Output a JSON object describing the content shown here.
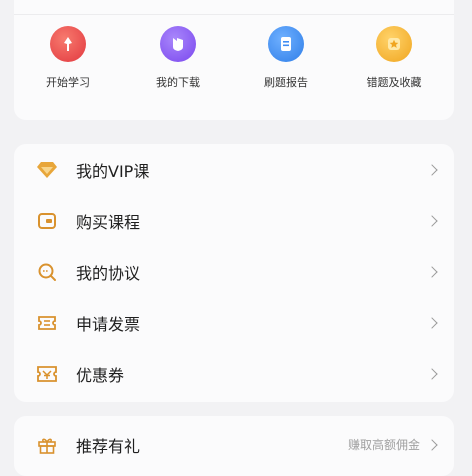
{
  "quick_actions": [
    {
      "label": "开始学习",
      "icon": "pen-icon",
      "color": "#e7474c"
    },
    {
      "label": "我的下载",
      "icon": "download-icon",
      "color": "#8b5cf6"
    },
    {
      "label": "刷题报告",
      "icon": "report-icon",
      "color": "#3f8df3"
    },
    {
      "label": "错题及收藏",
      "icon": "star-icon",
      "color": "#f3b532"
    }
  ],
  "menu": {
    "items": [
      {
        "label": "我的VIP课",
        "icon": "diamond-icon"
      },
      {
        "label": "购买课程",
        "icon": "wallet-icon"
      },
      {
        "label": "我的协议",
        "icon": "agreement-icon"
      },
      {
        "label": "申请发票",
        "icon": "invoice-icon"
      },
      {
        "label": "优惠券",
        "icon": "coupon-icon"
      }
    ]
  },
  "recommend": {
    "label": "推荐有礼",
    "note": "赚取高额佣金",
    "icon": "gift-icon"
  },
  "colors": {
    "accent": "#d9922e"
  }
}
